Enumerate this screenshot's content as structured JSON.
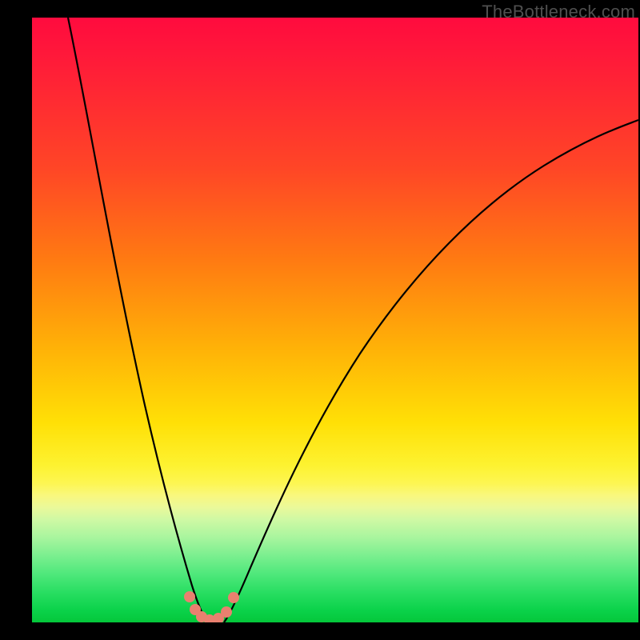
{
  "watermark": "TheBottleneck.com",
  "chart_data": {
    "type": "line",
    "title": "",
    "xlabel": "",
    "ylabel": "",
    "xlim": [
      0,
      100
    ],
    "ylim": [
      0,
      100
    ],
    "note": "Axes unlabeled in source image; values are pixel-fraction estimates (0–100) of the two curves and marker positions.",
    "series": [
      {
        "name": "left-curve",
        "x": [
          6,
          8,
          10,
          12,
          14,
          16,
          18,
          20,
          22,
          24,
          25.5,
          26.5,
          27,
          28
        ],
        "y": [
          100,
          90,
          79,
          68,
          57,
          46,
          36,
          26,
          17,
          9,
          4,
          1.5,
          0.5,
          0
        ]
      },
      {
        "name": "right-curve",
        "x": [
          32,
          33,
          35,
          38,
          42,
          48,
          55,
          63,
          72,
          82,
          92,
          100
        ],
        "y": [
          0,
          1.5,
          6,
          14,
          25,
          38,
          50,
          60,
          68,
          75,
          80,
          83
        ]
      }
    ],
    "markers": [
      {
        "x": 25.5,
        "y": 4.0
      },
      {
        "x": 26.5,
        "y": 1.8
      },
      {
        "x": 27.5,
        "y": 0.8
      },
      {
        "x": 29.0,
        "y": 0.4
      },
      {
        "x": 30.5,
        "y": 0.6
      },
      {
        "x": 31.8,
        "y": 1.6
      },
      {
        "x": 33.0,
        "y": 4.2
      }
    ],
    "marker_color": "#e9806f",
    "curve_color": "#000000"
  }
}
